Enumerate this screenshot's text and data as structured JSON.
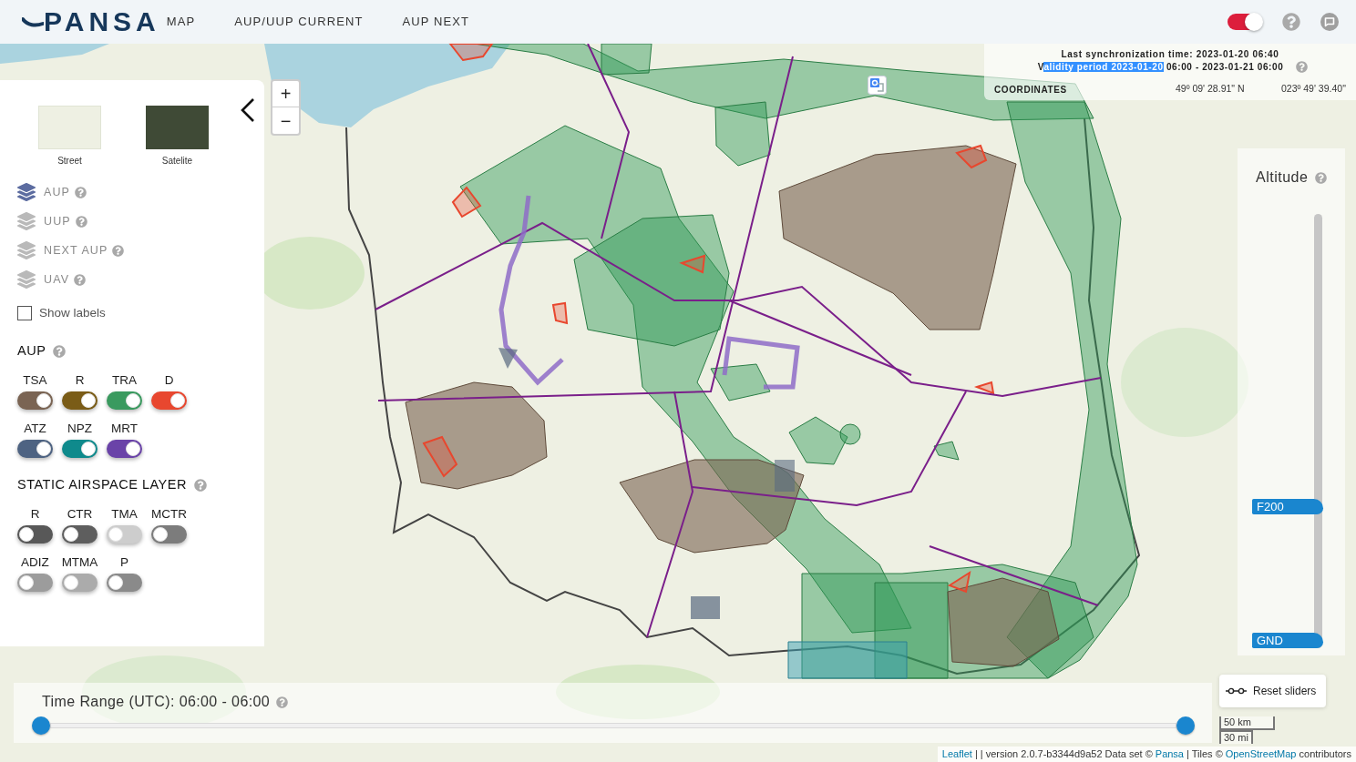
{
  "header": {
    "logo": "PANSA",
    "nav": [
      {
        "label": "MAP",
        "selected": false
      },
      {
        "label": "AUP/UUP CURRENT",
        "selected": false
      },
      {
        "label": "AUP NEXT",
        "selected": false
      }
    ],
    "language_toggle": {
      "on": true
    }
  },
  "info": {
    "last_sync": "Last synchronization time: 2023-01-20 06:40",
    "validity": [
      {
        "text": "V",
        "highlighted": false
      },
      {
        "text": "alidity period 2023-01-20",
        "highlighted": true
      },
      {
        "text": " 06:00 - 2023-01-21 06:00",
        "highlighted": false
      }
    ],
    "coordinates_label": "COORDINATES",
    "latitude": "49º 09' 28.91\" N",
    "longitude": "023º 49' 39.40\""
  },
  "zoom_buttons": [
    "+",
    "−"
  ],
  "sidebar": {
    "base_layers": [
      {
        "label": "Street",
        "kind": "street"
      },
      {
        "label": "Satelite",
        "kind": "satellite"
      }
    ],
    "layers": [
      {
        "label": "AUP",
        "selected": true
      },
      {
        "label": "UUP",
        "selected": false
      },
      {
        "label": "NEXT AUP",
        "selected": false
      },
      {
        "label": "UAV",
        "selected": false
      }
    ],
    "show_labels": {
      "label": "Show labels",
      "checked": false
    },
    "aup": {
      "title": "AUP",
      "rows": [
        [
          {
            "label": "TSA",
            "on": true,
            "color": "#7a6453"
          },
          {
            "label": "R",
            "on": true,
            "color": "#7a5c17"
          },
          {
            "label": "TRA",
            "on": true,
            "color": "#3a9a5f"
          },
          {
            "label": "D",
            "on": true,
            "color": "#e8472f"
          }
        ],
        [
          {
            "label": "ATZ",
            "on": true,
            "color": "#4e6382"
          },
          {
            "label": "NPZ",
            "on": true,
            "color": "#0f8a8c"
          },
          {
            "label": "MRT",
            "on": true,
            "color": "#6a43a8"
          }
        ]
      ]
    },
    "static_layer": {
      "title": "STATIC AIRSPACE LAYER",
      "rows": [
        [
          {
            "label": "R",
            "on": false,
            "color": "#585858"
          },
          {
            "label": "CTR",
            "on": false,
            "color": "#5e5e5e"
          },
          {
            "label": "TMA",
            "on": false,
            "color": "#cdcdcd"
          },
          {
            "label": "MCTR",
            "on": false,
            "color": "#7c7c7c"
          }
        ],
        [
          {
            "label": "ADIZ",
            "on": false,
            "color": "#9c9c9c"
          },
          {
            "label": "MTMA",
            "on": false,
            "color": "#ababab"
          },
          {
            "label": "P",
            "on": false,
            "color": "#8a8a8a"
          }
        ]
      ]
    }
  },
  "altitude": {
    "title": "Altitude",
    "handles": [
      {
        "label": "F200",
        "level": 0.32
      },
      {
        "label": "GND",
        "level": 0
      }
    ]
  },
  "time_range": {
    "title": "Time Range (UTC): 06:00 - 06:00",
    "handles": [
      {
        "level": 0
      },
      {
        "level": 1
      }
    ]
  },
  "reset_button": "Reset sliders",
  "scale": [
    "50 km",
    "30 mi"
  ],
  "attribution": [
    {
      "text": "Leaflet",
      "link": true
    },
    {
      "text": " | | version 2.0.7-b3344d9a52 Data set © ",
      "link": false
    },
    {
      "text": "Pansa",
      "link": true
    },
    {
      "text": " | Tiles © ",
      "link": false
    },
    {
      "text": "OpenStreetMap",
      "link": true
    },
    {
      "text": " contributors",
      "link": false
    }
  ]
}
